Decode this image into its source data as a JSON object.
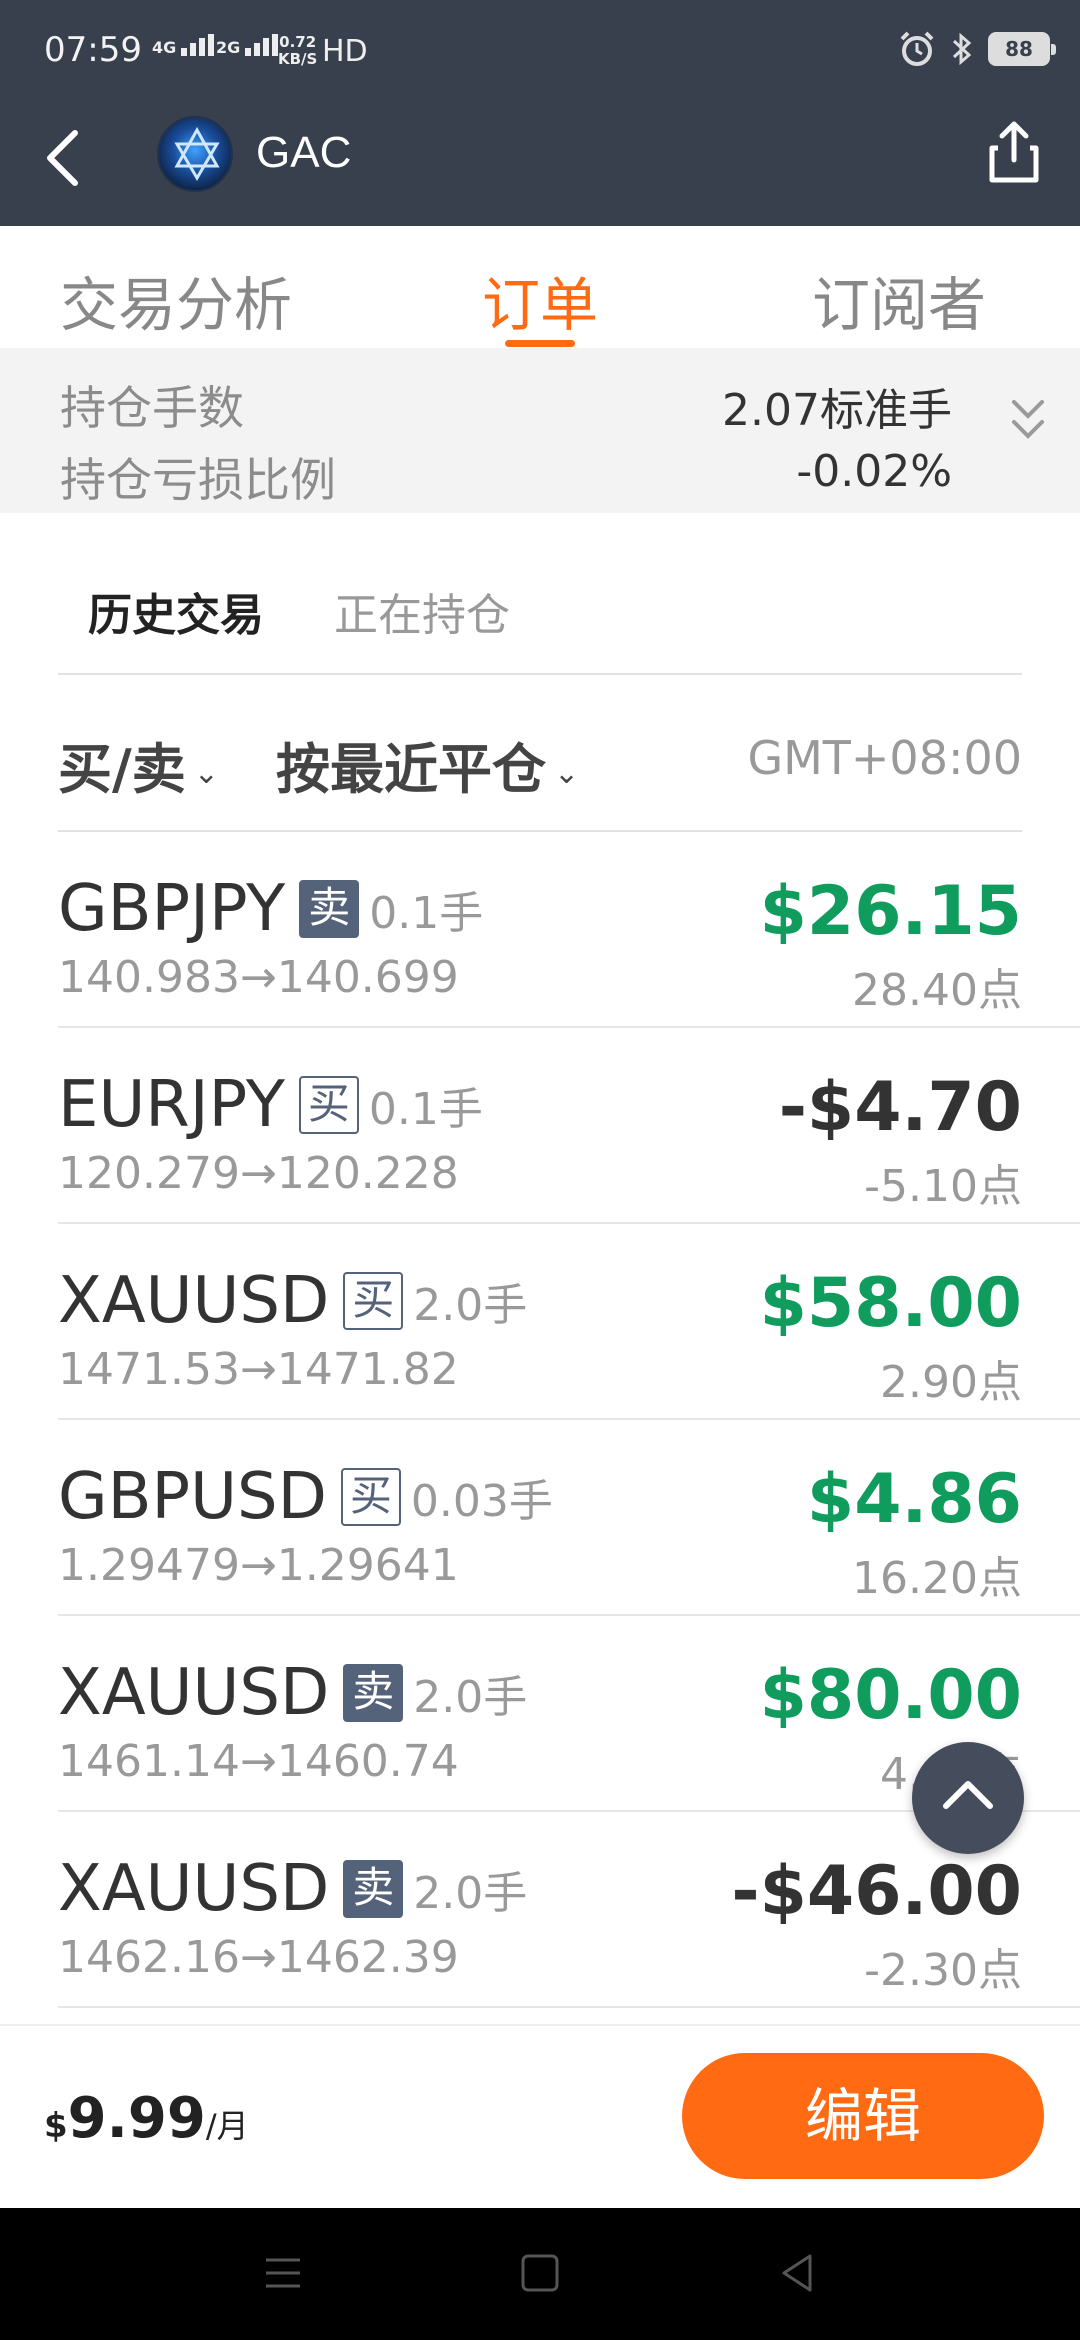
{
  "status_bar": {
    "time": "07:59",
    "sim1": "4G",
    "sim2": "2G",
    "net_speed_value": "0.72",
    "net_speed_unit": "KB/S",
    "hd": "HD",
    "battery": "88"
  },
  "header": {
    "title": "GAC",
    "back_icon": "chevron-left-icon",
    "share_icon": "share-icon"
  },
  "tabs": [
    {
      "label": "交易分析",
      "active": false
    },
    {
      "label": "订单",
      "active": true
    },
    {
      "label": "订阅者",
      "active": false
    }
  ],
  "summary": {
    "lots_label": "持仓手数",
    "lots_value": "2.07标准手",
    "pl_ratio_label": "持仓亏损比例",
    "pl_ratio_value": "-0.02%"
  },
  "sub_tabs": [
    {
      "label": "历史交易",
      "active": true
    },
    {
      "label": "正在持仓",
      "active": false
    }
  ],
  "filters": {
    "side": "买/卖",
    "sort": "按最近平仓",
    "timezone": "GMT+08:00"
  },
  "orders": [
    {
      "symbol": "GBPJPY",
      "side": "卖",
      "lots": "0.1手",
      "open": "140.983",
      "close": "140.699",
      "profit": "$26.15",
      "points": "28.40点",
      "positive": true
    },
    {
      "symbol": "EURJPY",
      "side": "买",
      "lots": "0.1手",
      "open": "120.279",
      "close": "120.228",
      "profit": "-$4.70",
      "points": "-5.10点",
      "positive": false
    },
    {
      "symbol": "XAUUSD",
      "side": "买",
      "lots": "2.0手",
      "open": "1471.53",
      "close": "1471.82",
      "profit": "$58.00",
      "points": "2.90点",
      "positive": true
    },
    {
      "symbol": "GBPUSD",
      "side": "买",
      "lots": "0.03手",
      "open": "1.29479",
      "close": "1.29641",
      "profit": "$4.86",
      "points": "16.20点",
      "positive": true
    },
    {
      "symbol": "XAUUSD",
      "side": "卖",
      "lots": "2.0手",
      "open": "1461.14",
      "close": "1460.74",
      "profit": "$80.00",
      "points": "4.00点",
      "positive": true
    },
    {
      "symbol": "XAUUSD",
      "side": "卖",
      "lots": "2.0手",
      "open": "1462.16",
      "close": "1462.39",
      "profit": "-$46.00",
      "points": "-2.30点",
      "positive": false
    }
  ],
  "arrow": "→",
  "bottom": {
    "currency": "$",
    "price": "9.99",
    "period": "/月",
    "edit_label": "编辑"
  },
  "colors": {
    "header_bg": "#38404d",
    "accent": "#ff6a13",
    "profit_green": "#0f9c5c",
    "badge_blue": "#55637a"
  }
}
